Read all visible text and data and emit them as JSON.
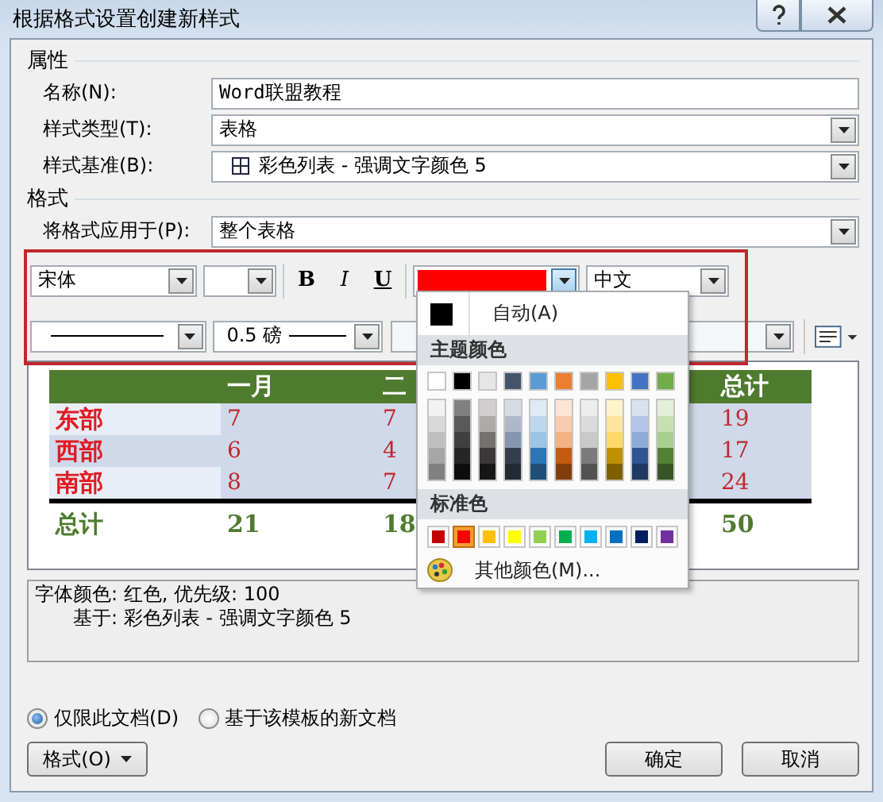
{
  "window": {
    "title": "根据格式设置创建新样式"
  },
  "properties": {
    "heading": "属性",
    "fields": [
      {
        "label": "名称(N):",
        "kind": "text",
        "value": "Word联盟教程"
      },
      {
        "label": "样式类型(T):",
        "kind": "dropdown",
        "value": "表格"
      },
      {
        "label": "样式基准(B):",
        "kind": "style-dropdown",
        "value": "彩色列表 - 强调文字颜色 5"
      }
    ]
  },
  "format": {
    "heading": "格式",
    "apply_to": {
      "label": "将格式应用于(P):",
      "value": "整个表格"
    },
    "font": "宋体",
    "bold": "B",
    "italic": "I",
    "underline": "U",
    "font_color": {
      "color": "#ff0000"
    },
    "language": "中文",
    "border_width": "0.5 磅"
  },
  "preview": {
    "columns": [
      "一月",
      "二",
      "总计"
    ],
    "rows": [
      {
        "kind": "data",
        "label": "东部",
        "values": [
          "7",
          "7",
          "19"
        ]
      },
      {
        "kind": "data",
        "label": "西部",
        "values": [
          "6",
          "4",
          "17"
        ]
      },
      {
        "kind": "data",
        "label": "南部",
        "values": [
          "8",
          "7",
          "24"
        ]
      },
      {
        "kind": "total",
        "label": "总计",
        "values": [
          "21",
          "18",
          "50"
        ]
      }
    ]
  },
  "description": [
    "字体颜色: 红色, 优先级: 100",
    "基于: 彩色列表 - 强调文字颜色 5"
  ],
  "color_menu": {
    "automatic": {
      "label": "自动(A)",
      "color": "#000000"
    },
    "theme_heading": "主题颜色",
    "theme_colors": [
      {
        "color": "#ffffff",
        "shades": [
          {
            "color": "#f2f2f2"
          },
          {
            "color": "#d9d9d9"
          },
          {
            "color": "#bfbfbf"
          },
          {
            "color": "#a6a6a6"
          },
          {
            "color": "#808080"
          }
        ]
      },
      {
        "color": "#000000",
        "shades": [
          {
            "color": "#808080"
          },
          {
            "color": "#595959"
          },
          {
            "color": "#404040"
          },
          {
            "color": "#262626"
          },
          {
            "color": "#0d0d0d"
          }
        ]
      },
      {
        "color": "#e7e6e6",
        "shades": [
          {
            "color": "#d0cece"
          },
          {
            "color": "#aeaaaa"
          },
          {
            "color": "#757171"
          },
          {
            "color": "#3a3838"
          },
          {
            "color": "#171616"
          }
        ]
      },
      {
        "color": "#44546a",
        "shades": [
          {
            "color": "#d6dce4"
          },
          {
            "color": "#adb9ca"
          },
          {
            "color": "#8497b0"
          },
          {
            "color": "#333f4f"
          },
          {
            "color": "#222a35"
          }
        ]
      },
      {
        "color": "#5b9bd5",
        "shades": [
          {
            "color": "#deebf6"
          },
          {
            "color": "#bdd7ee"
          },
          {
            "color": "#9dc3e6"
          },
          {
            "color": "#2e75b5"
          },
          {
            "color": "#1f4e79"
          }
        ]
      },
      {
        "color": "#ed7d31",
        "shades": [
          {
            "color": "#fbe5d5"
          },
          {
            "color": "#f7cbac"
          },
          {
            "color": "#f4b183"
          },
          {
            "color": "#c55a11"
          },
          {
            "color": "#833c0b"
          }
        ]
      },
      {
        "color": "#a5a5a5",
        "shades": [
          {
            "color": "#ededed"
          },
          {
            "color": "#dbdbdb"
          },
          {
            "color": "#c9c9c9"
          },
          {
            "color": "#7b7b7b"
          },
          {
            "color": "#525252"
          }
        ]
      },
      {
        "color": "#ffc000",
        "shades": [
          {
            "color": "#fff2cc"
          },
          {
            "color": "#fee599"
          },
          {
            "color": "#ffd965"
          },
          {
            "color": "#bf9000"
          },
          {
            "color": "#7f6000"
          }
        ]
      },
      {
        "color": "#4472c4",
        "shades": [
          {
            "color": "#d9e2f3"
          },
          {
            "color": "#b4c6e7"
          },
          {
            "color": "#8eaadb"
          },
          {
            "color": "#2f5496"
          },
          {
            "color": "#1f3864"
          }
        ]
      },
      {
        "color": "#70ad47",
        "shades": [
          {
            "color": "#e2efd9"
          },
          {
            "color": "#c5e0b3"
          },
          {
            "color": "#a8d08d"
          },
          {
            "color": "#538135"
          },
          {
            "color": "#375623"
          }
        ]
      }
    ],
    "standard_heading": "标准色",
    "standard_colors": [
      {
        "color": "#c00000",
        "selected": false
      },
      {
        "color": "#ff0000",
        "selected": true
      },
      {
        "color": "#ffc000",
        "selected": false
      },
      {
        "color": "#ffff00",
        "selected": false
      },
      {
        "color": "#92d050",
        "selected": false
      },
      {
        "color": "#00b050",
        "selected": false
      },
      {
        "color": "#00b0f0",
        "selected": false
      },
      {
        "color": "#0070c0",
        "selected": false
      },
      {
        "color": "#002060",
        "selected": false
      },
      {
        "color": "#7030a0",
        "selected": false
      }
    ],
    "more": "其他颜色(M)..."
  },
  "scope": [
    {
      "label": "仅限此文档(D)",
      "selected": true
    },
    {
      "label": "基于该模板的新文档",
      "selected": false
    }
  ],
  "buttons": {
    "format": "格式(O)",
    "ok": "确定",
    "cancel": "取消"
  }
}
